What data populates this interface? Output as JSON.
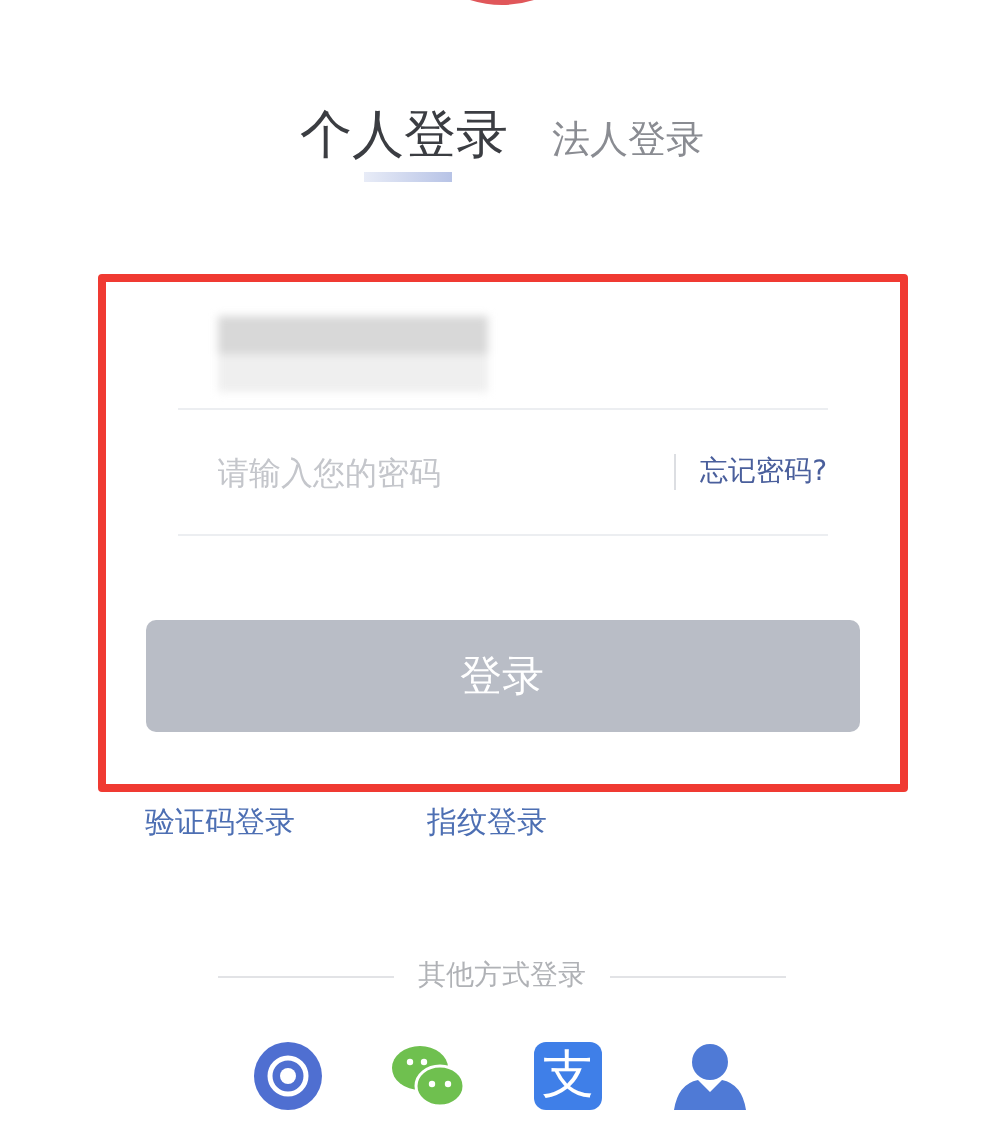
{
  "tabs": [
    {
      "label": "个人登录",
      "selected": true
    },
    {
      "label": "法人登录",
      "selected": false
    }
  ],
  "form": {
    "username": {
      "blurred": true
    },
    "password": {
      "placeholder": "请输入您的密码"
    },
    "forgot_link": "忘记密码?",
    "login_button": {
      "label": "登录",
      "disabled": true
    },
    "highlighted": true
  },
  "alt_links": [
    "验证码登录",
    "指纹登录"
  ],
  "other_methods": {
    "title": "其他方式登录",
    "icons": [
      {
        "kind": "social-security"
      },
      {
        "kind": "chat"
      },
      {
        "kind": "pay",
        "glyph": "支"
      },
      {
        "kind": "person"
      }
    ]
  }
}
